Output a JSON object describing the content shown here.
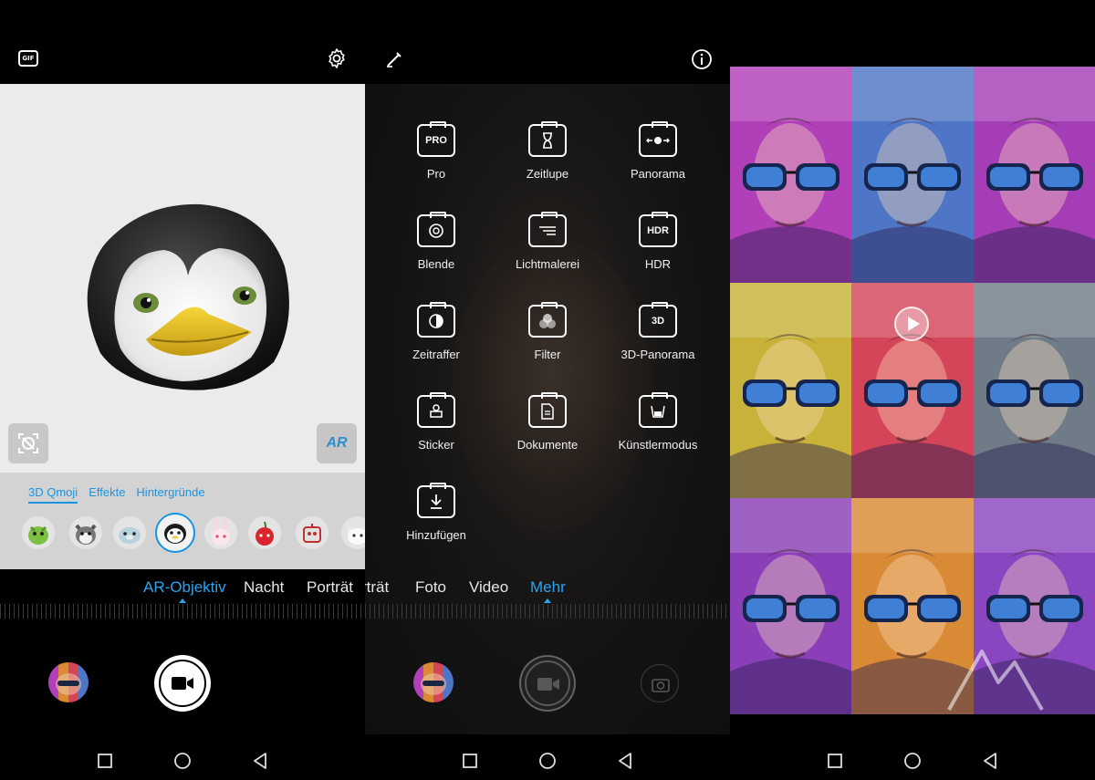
{
  "panel1": {
    "gif_label": "GIF",
    "tray_tabs": [
      "3D Qmoji",
      "Effekte",
      "Hintergründe"
    ],
    "ar_label": "AR",
    "modes": [
      "AR-Objektiv",
      "Nacht",
      "Porträt"
    ],
    "active_mode": "AR-Objektiv"
  },
  "panel2": {
    "modes_grid": [
      {
        "label": "Pro",
        "icon": "pro-icon",
        "glyph": "PRO"
      },
      {
        "label": "Zeitlupe",
        "icon": "hourglass-icon",
        "glyph": ""
      },
      {
        "label": "Panorama",
        "icon": "panorama-icon",
        "glyph": ""
      },
      {
        "label": "Blende",
        "icon": "aperture-icon",
        "glyph": ""
      },
      {
        "label": "Lichtmalerei",
        "icon": "light-painting-icon",
        "glyph": ""
      },
      {
        "label": "HDR",
        "icon": "hdr-icon",
        "glyph": "HDR"
      },
      {
        "label": "Zeitraffer",
        "icon": "timelapse-icon",
        "glyph": ""
      },
      {
        "label": "Filter",
        "icon": "filter-icon",
        "glyph": ""
      },
      {
        "label": "3D-Panorama",
        "icon": "3d-panorama-icon",
        "glyph": "3D"
      },
      {
        "label": "Sticker",
        "icon": "sticker-icon",
        "glyph": ""
      },
      {
        "label": "Dokumente",
        "icon": "document-icon",
        "glyph": ""
      },
      {
        "label": "Künstlermodus",
        "icon": "artist-icon",
        "glyph": ""
      },
      {
        "label": "Hinzufügen",
        "icon": "download-icon",
        "glyph": ""
      }
    ],
    "modes": [
      "rträt",
      "Foto",
      "Video",
      "Mehr"
    ],
    "active_mode": "Mehr"
  },
  "colors": {
    "accent": "#2aa3ee",
    "tray_bg": "#d3d3d3",
    "viewfinder_bg": "#ebebeb"
  },
  "panel3": {
    "filter_tints": [
      "#b13fb8",
      "#4f76c6",
      "#a53db6",
      "#c9b23a",
      "#d4455a",
      "#6f7c88",
      "#8a3fb8",
      "#d98a35",
      "#8a45c0"
    ]
  }
}
